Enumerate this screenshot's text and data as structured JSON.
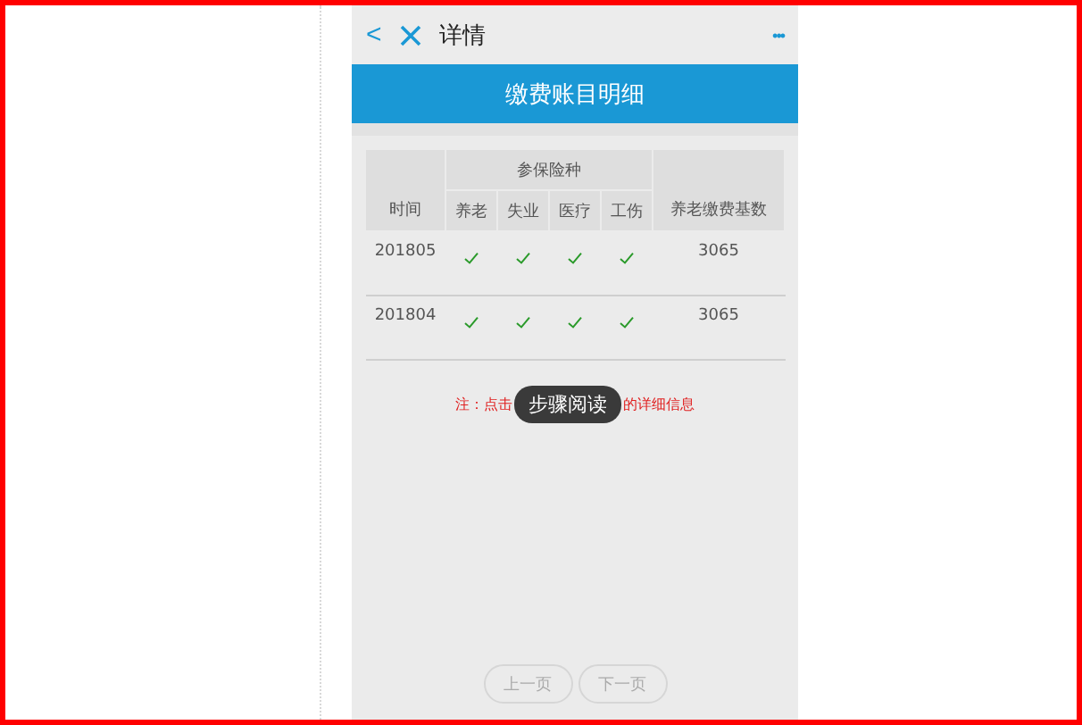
{
  "nav": {
    "back": "<",
    "title": "详情",
    "more": "•••"
  },
  "banner": {
    "title": "缴费账目明细"
  },
  "table": {
    "group_header": "参保险种",
    "time_header": "时间",
    "insurance_headers": [
      "养老",
      "失业",
      "医疗",
      "工伤"
    ],
    "base_header": "养老缴费基数",
    "rows": [
      {
        "time": "201805",
        "paid": [
          true,
          true,
          true,
          true
        ],
        "base": "3065"
      },
      {
        "time": "201804",
        "paid": [
          true,
          true,
          true,
          true
        ],
        "base": "3065"
      }
    ]
  },
  "note": {
    "before": "注：点击",
    "after": "的详细信息"
  },
  "toast": "步骤阅读",
  "pager": [
    {
      "label": "上一页",
      "disabled": true
    },
    {
      "label": "下一页",
      "disabled": true
    }
  ]
}
